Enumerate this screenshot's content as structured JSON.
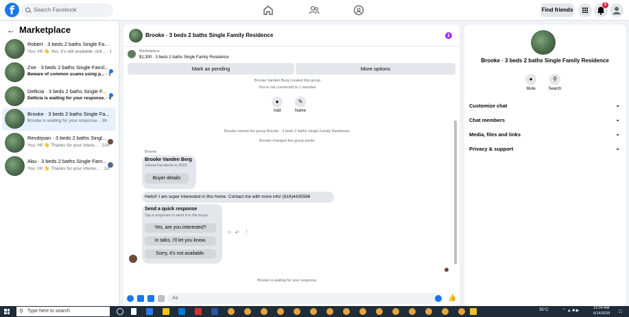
{
  "nav": {
    "search_placeholder": "Search Facebook",
    "find_friends": "Find friends",
    "notif_count": "2"
  },
  "sidebar": {
    "title": "Marketplace",
    "conversations": [
      {
        "name": "Robert · 3 beds 2 baths Single Fam...",
        "preview": "You: Hi! 👋 Yes, it's still available. onli...",
        "time": "1m"
      },
      {
        "name": "Zoe · 3 beds 2 baths Single Famil...",
        "preview": "Beware of common scams using p...",
        "time": "1m"
      },
      {
        "name": "Dellicia · 3 beds 2 baths Single F...",
        "preview": "Dellicia is waiting for your response.",
        "time": "6h"
      },
      {
        "name": "Brooke · 3 beds 2 baths Single Fa...",
        "preview": "Brooke is waiting for your response.",
        "time": "9h"
      },
      {
        "name": "Revdrjoan · 3 beds 2 baths Singl...",
        "preview": "You: Hi! 👋 Thanks for your intere...",
        "time": "21h"
      },
      {
        "name": "Abu · 3 beds 2 baths Single Fam...",
        "preview": "You: Hi! 👋 Thanks for your interes...",
        "time": "1d"
      }
    ]
  },
  "chat": {
    "title": "Brooke · 3 beds 2 baths Single Family Residence",
    "listing_label": "Marketplace",
    "listing_text": "$1,300 · 3 beds 2 baths Single Family Residence",
    "mark_pending": "Mark as pending",
    "more_options": "More options",
    "created_group": "Brooke Vanden Berg created this group",
    "not_connected": "You're not connected to 1 member",
    "add_label": "Add",
    "name_label": "Name",
    "named_group": "Brooke named the group Brooke · 3 beds 2 baths Single Family Residence.",
    "changed_photo": "Brooke changed the group photo.",
    "sender": "Brooke",
    "profile_name": "Brooke Vanden Berg",
    "profile_sub": "Joined Facebook in 2023",
    "buyer_details": "Buyer details",
    "message": "Hello!! I am super interested in this home. Contact me with more info! (616)4435586",
    "quick_title": "Send a quick response",
    "quick_sub": "Tap a response to send it to the buyer.",
    "quick_1": "Yes, are you interested?",
    "quick_2": "In talks. I'll let you know.",
    "quick_3": "Sorry, it's not available.",
    "waiting": "Brooke is waiting for your response.",
    "composer_placeholder": "Aa"
  },
  "panel": {
    "title": "Brooke · 3 beds 2 baths Single Family Residence",
    "mute": "Mute",
    "search": "Search",
    "rows": [
      "Customize chat",
      "Chat members",
      "Media, files and links",
      "Privacy & support"
    ]
  },
  "taskbar": {
    "search_placeholder": "Type here to search",
    "temp": "35°C",
    "time": "12:04 AM",
    "date": "6/14/2025",
    "accent": "#1877f2"
  }
}
